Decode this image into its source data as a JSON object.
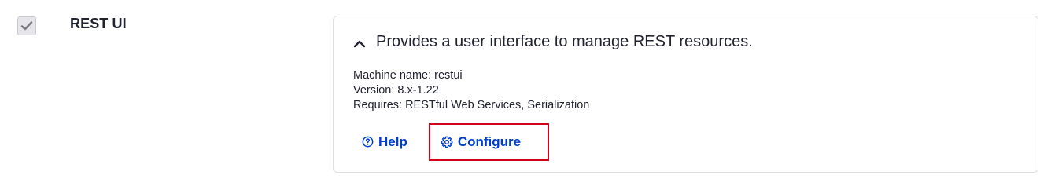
{
  "module": {
    "name": "REST UI",
    "enabled": true,
    "description": "Provides a user interface to manage REST resources.",
    "meta": {
      "machine_name": "Machine name: restui",
      "version": "Version: 8.x-1.22",
      "requires": "Requires: RESTful Web Services, Serialization"
    },
    "actions": {
      "help_label": "Help",
      "configure_label": "Configure"
    }
  },
  "icons": {
    "checkbox": "checkmark-icon",
    "chevron": "chevron-up-icon",
    "help": "question-circle-icon",
    "configure": "gear-icon"
  },
  "colors": {
    "link": "#003ecc",
    "text": "#222330",
    "highlight_border": "#d0021b",
    "card_border": "#dedee3",
    "checkbox_bg": "#e6e6ea"
  }
}
